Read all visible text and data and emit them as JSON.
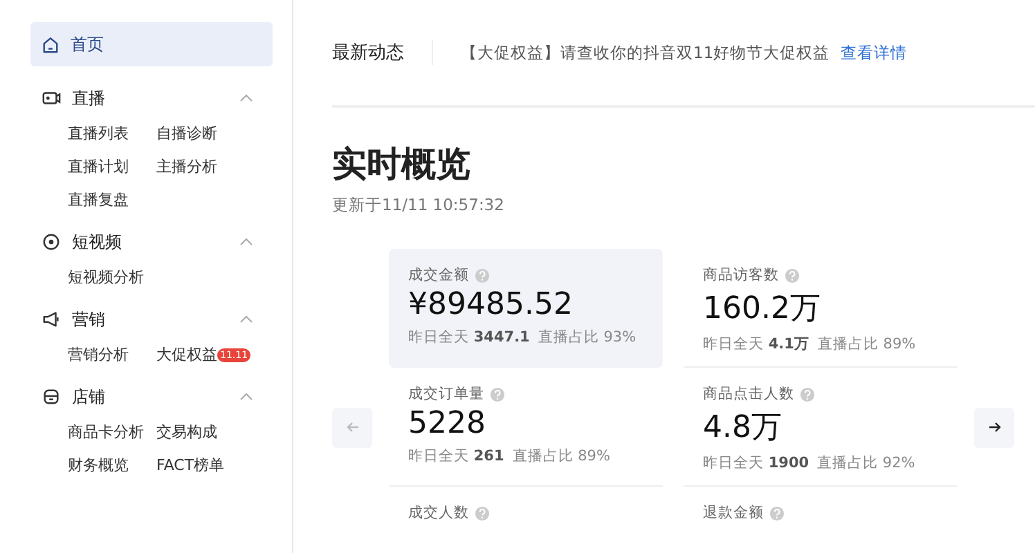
{
  "sidebar": {
    "home": {
      "label": "首页",
      "selected": true
    },
    "sections": [
      {
        "kind": "live",
        "title": "直播",
        "expanded": true,
        "items": [
          {
            "label": "直播列表"
          },
          {
            "label": "自播诊断"
          },
          {
            "label": "直播计划"
          },
          {
            "label": "主播分析"
          },
          {
            "label": "直播复盘"
          }
        ]
      },
      {
        "kind": "video",
        "title": "短视频",
        "expanded": true,
        "items": [
          {
            "label": "短视频分析"
          }
        ]
      },
      {
        "kind": "marketing",
        "title": "营销",
        "expanded": true,
        "items": [
          {
            "label": "营销分析"
          },
          {
            "label": "大促权益",
            "badge": "11.11"
          }
        ]
      },
      {
        "kind": "shop",
        "title": "店铺",
        "expanded": true,
        "items": [
          {
            "label": "商品卡分析"
          },
          {
            "label": "交易构成"
          },
          {
            "label": "财务概览"
          },
          {
            "label": "FACT榜单"
          }
        ]
      }
    ]
  },
  "news": {
    "title": "最新动态",
    "message": "【大促权益】请查收你的抖音双11好物节大促权益",
    "link": "查看详情"
  },
  "overview": {
    "title": "实时概览",
    "updated": "更新于11/11  10:57:32",
    "cards": [
      {
        "label": "成交金额",
        "value": "¥89485.52",
        "yesterday_label": "昨日全天",
        "yesterday": "3447.1",
        "share_label": "直播占比",
        "share": "93%",
        "selected": true
      },
      {
        "label": "商品访客数",
        "value": "160.2万",
        "yesterday_label": "昨日全天",
        "yesterday": "4.1万",
        "share_label": "直播占比",
        "share": "89%",
        "selected": false
      },
      {
        "label": "成交订单量",
        "value": "5228",
        "yesterday_label": "昨日全天",
        "yesterday": "261",
        "share_label": "直播占比",
        "share": "89%",
        "selected": false
      },
      {
        "label": "商品点击人数",
        "value": "4.8万",
        "yesterday_label": "昨日全天",
        "yesterday": "1900",
        "share_label": "直播占比",
        "share": "92%",
        "selected": false
      },
      {
        "label": "成交人数",
        "selected": false
      },
      {
        "label": "退款金额",
        "selected": false
      }
    ]
  }
}
